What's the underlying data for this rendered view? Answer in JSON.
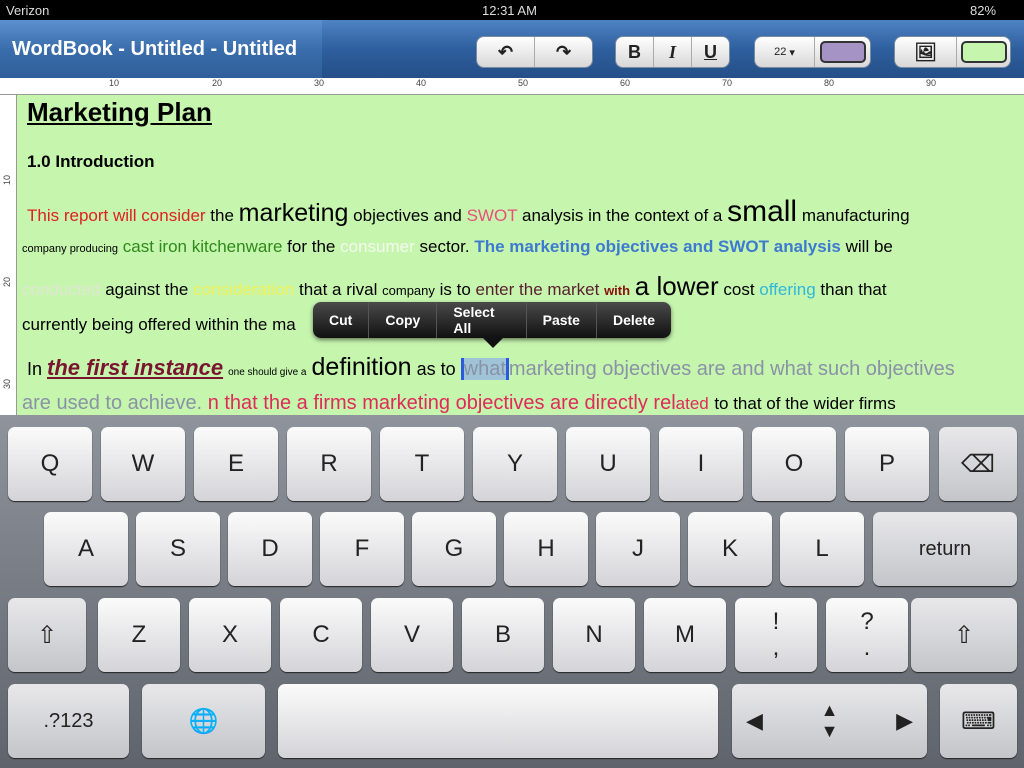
{
  "status": {
    "carrier": "Verizon",
    "time": "12:31 AM",
    "battery": "82%"
  },
  "toolbar": {
    "title": "WordBook - Untitled - Untitled",
    "undo_icon": "undo-icon",
    "redo_icon": "redo-icon",
    "bold": "B",
    "italic": "I",
    "underline": "U",
    "font_size": "22",
    "text_color": "#a493c4",
    "image_icon": "image-icon",
    "background_color": "#c6f5ae"
  },
  "ruler": {
    "marks": [
      "10",
      "20",
      "30",
      "40",
      "50",
      "60",
      "70",
      "80",
      "90"
    ],
    "vmarks": [
      "10",
      "20",
      "30"
    ]
  },
  "document": {
    "heading": "Marketing Plan",
    "subheading": "1.0 Introduction",
    "l1": [
      "This report will consider",
      "the",
      "marketing",
      "objectives and",
      "SWOT",
      "analysis in the context of a",
      "small",
      "manufacturing"
    ],
    "l2": [
      "company producing",
      "cast iron kitchenware",
      "for the",
      "consumer",
      "sector.",
      "The marketing objectives and SWOT analysis",
      "will be"
    ],
    "l3": [
      "conducted",
      "against the",
      "consideration",
      "that a rival",
      "company",
      "is to",
      "enter the market",
      "with",
      "a lower",
      "cost",
      "offering",
      "than that"
    ],
    "l4": [
      "currently being offered within the ma"
    ],
    "l5": [
      "In",
      "the first instance",
      "one should give a",
      "definition",
      "as to",
      "what",
      "marketing objectives are and what such objectives"
    ],
    "l6": [
      "are used to achieve.",
      "n that the a firms marketing objectives are directly rel",
      "ated",
      "to that of the wider firms"
    ]
  },
  "context_menu": [
    "Cut",
    "Copy",
    "Select All",
    "Paste",
    "Delete"
  ],
  "keyboard": {
    "row1": [
      "Q",
      "W",
      "E",
      "R",
      "T",
      "Y",
      "U",
      "I",
      "O",
      "P"
    ],
    "row2": [
      "A",
      "S",
      "D",
      "F",
      "G",
      "H",
      "J",
      "K",
      "L"
    ],
    "row3": [
      "Z",
      "X",
      "C",
      "V",
      "B",
      "N",
      "M",
      "!\n,",
      "?\n."
    ],
    "return": "return",
    "numbers": ".?123",
    "shift": "⇧",
    "backspace": "⌫",
    "globe": "🌐",
    "hide": "⌨"
  }
}
